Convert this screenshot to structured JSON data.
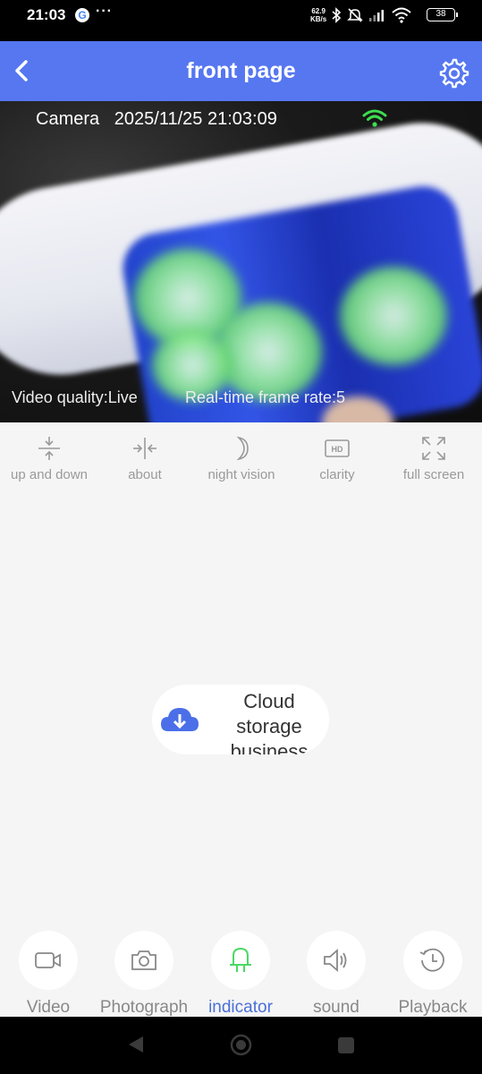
{
  "status_bar": {
    "time": "21:03",
    "google_icon": "G",
    "more": "···",
    "net_speed_value": "62.9",
    "net_speed_unit": "KB/s",
    "battery": "38"
  },
  "header": {
    "title": "front page"
  },
  "video": {
    "camera_label": "Camera   2025/11/25 21:03:09",
    "quality_label": "Video quality:Live",
    "frame_rate_label": "Real-time frame rate:5"
  },
  "controls": [
    {
      "label": "up and down",
      "icon": "vertical-flip-icon"
    },
    {
      "label": "about",
      "icon": "horizontal-flip-icon"
    },
    {
      "label": "night vision",
      "icon": "moon-icon"
    },
    {
      "label": "clarity",
      "icon": "hd-icon",
      "badge": "HD"
    },
    {
      "label": "full screen",
      "icon": "fullscreen-icon"
    }
  ],
  "cloud_storage": {
    "label": "Cloud storage business"
  },
  "bottom_actions": [
    {
      "label": "Video",
      "icon": "video-camera-icon",
      "active": false
    },
    {
      "label": "Photograph",
      "icon": "camera-icon",
      "active": false
    },
    {
      "label": "indicator",
      "icon": "light-bulb-icon",
      "active": true
    },
    {
      "label": "sound",
      "icon": "speaker-icon",
      "active": false
    },
    {
      "label": "Playback",
      "icon": "history-icon",
      "active": false
    }
  ],
  "colors": {
    "header_bg": "#5677f0",
    "active_label": "#4a6fd8",
    "indicator_green": "#4cd964",
    "wifi_green": "#3ddc4f",
    "cloud_blue": "#4a6fe8"
  }
}
